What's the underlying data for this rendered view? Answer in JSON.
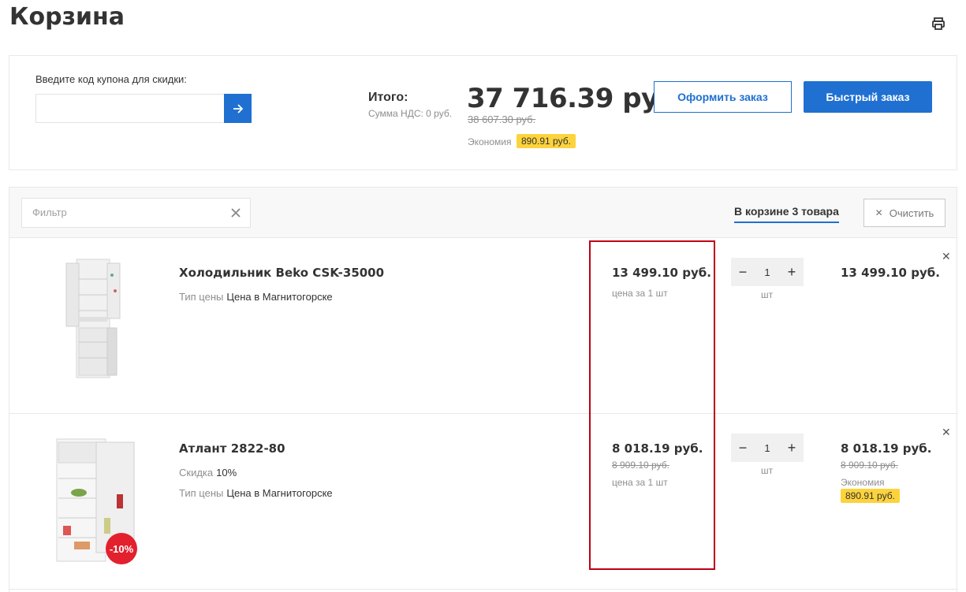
{
  "page": {
    "title": "Корзина"
  },
  "summary": {
    "coupon_label": "Введите код купона для скидки:",
    "coupon_value": "",
    "total_label": "Итого:",
    "vat_label": "Сумма НДС: 0 руб.",
    "total_value": "37 716.39 руб.",
    "total_old": "38 607.30 руб.",
    "saving_label": "Экономия",
    "saving_value": "890.91 руб.",
    "order_label": "Оформить заказ",
    "quick_order_label": "Быстрый заказ"
  },
  "toolbar": {
    "filter_placeholder": "Фильтр",
    "count_label": "В корзине 3 товара",
    "clear_label": "Очистить"
  },
  "items": [
    {
      "name": "Холодильник Beko CSK-35000",
      "props": [
        {
          "key": "Тип цены",
          "value": "Цена в Магнитогорске"
        }
      ],
      "price": "13 499.10 руб.",
      "price_old": "",
      "price_note": "цена за 1 шт",
      "quantity": "1",
      "unit": "шт",
      "sum": "13 499.10 руб.",
      "sum_old": "",
      "sum_saving_label": "",
      "sum_saving": ""
    },
    {
      "name": "Атлант 2822-80",
      "props": [
        {
          "key": "Скидка",
          "value": "10%"
        },
        {
          "key": "Тип цены",
          "value": "Цена в Магнитогорске"
        }
      ],
      "discount_badge": "-10%",
      "price": "8 018.19 руб.",
      "price_old": "8 909.10 руб.",
      "price_note": "цена за 1 шт",
      "quantity": "1",
      "unit": "шт",
      "sum": "8 018.19 руб.",
      "sum_old": "8 909.10 руб.",
      "sum_saving_label": "Экономия",
      "sum_saving": "890.91 руб."
    }
  ],
  "colors": {
    "accent": "#1f70d1",
    "badge": "#fcd33c",
    "discount": "#e3202e",
    "highlight": "#c00014"
  },
  "icons": [
    "print-icon",
    "arrow-right-icon",
    "close-icon",
    "minus-icon",
    "plus-icon",
    "delete-icon"
  ]
}
